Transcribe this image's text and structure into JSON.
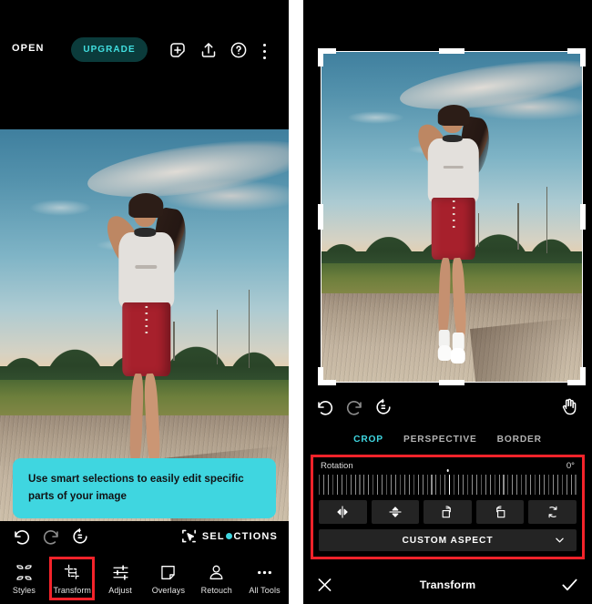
{
  "left_panel": {
    "header": {
      "open_label": "OPEN",
      "upgrade_label": "UPGRADE",
      "icons": [
        "add-photo-icon",
        "export-icon",
        "help-icon",
        "overflow-menu-icon"
      ]
    },
    "tooltip": {
      "text": "Use smart selections to easily edit specific parts of your image",
      "background": "#3fd6e0"
    },
    "history": {
      "undo": "undo-icon",
      "redo": "redo-icon",
      "revert": "revert-icon"
    },
    "selections_badge": {
      "prefix": "SEL",
      "suffix": "CTIONS",
      "dot_color": "#3fd6e0"
    },
    "bottom_nav": {
      "active": "Transform",
      "highlight_color": "#f4232a",
      "items": [
        {
          "label": "Styles",
          "icon": "styles-icon"
        },
        {
          "label": "Transform",
          "icon": "transform-icon"
        },
        {
          "label": "Adjust",
          "icon": "adjust-icon"
        },
        {
          "label": "Overlays",
          "icon": "overlays-icon"
        },
        {
          "label": "Retouch",
          "icon": "retouch-icon"
        },
        {
          "label": "All Tools",
          "icon": "all-tools-icon"
        }
      ]
    }
  },
  "right_panel": {
    "crop_overlay": {
      "frame_color": "#ffffff"
    },
    "history": {
      "undo": "undo-icon",
      "redo": "redo-icon",
      "revert": "revert-icon",
      "pan": "hand-icon"
    },
    "tabs": {
      "active": "CROP",
      "active_color": "#3fd6e0",
      "items": [
        "CROP",
        "PERSPECTIVE",
        "BORDER"
      ]
    },
    "controls": {
      "highlight_color": "#f4232a",
      "rotation_label": "Rotation",
      "rotation_value": "0°",
      "tools": [
        {
          "name": "flip-horizontal-icon"
        },
        {
          "name": "flip-vertical-icon"
        },
        {
          "name": "rotate-right-icon"
        },
        {
          "name": "rotate-left-icon"
        },
        {
          "name": "rotate-90-icon"
        }
      ],
      "aspect_label": "CUSTOM ASPECT",
      "aspect_chevron": "chevron-down-icon"
    },
    "footer": {
      "cancel": "close-icon",
      "title": "Transform",
      "confirm": "check-icon"
    }
  }
}
